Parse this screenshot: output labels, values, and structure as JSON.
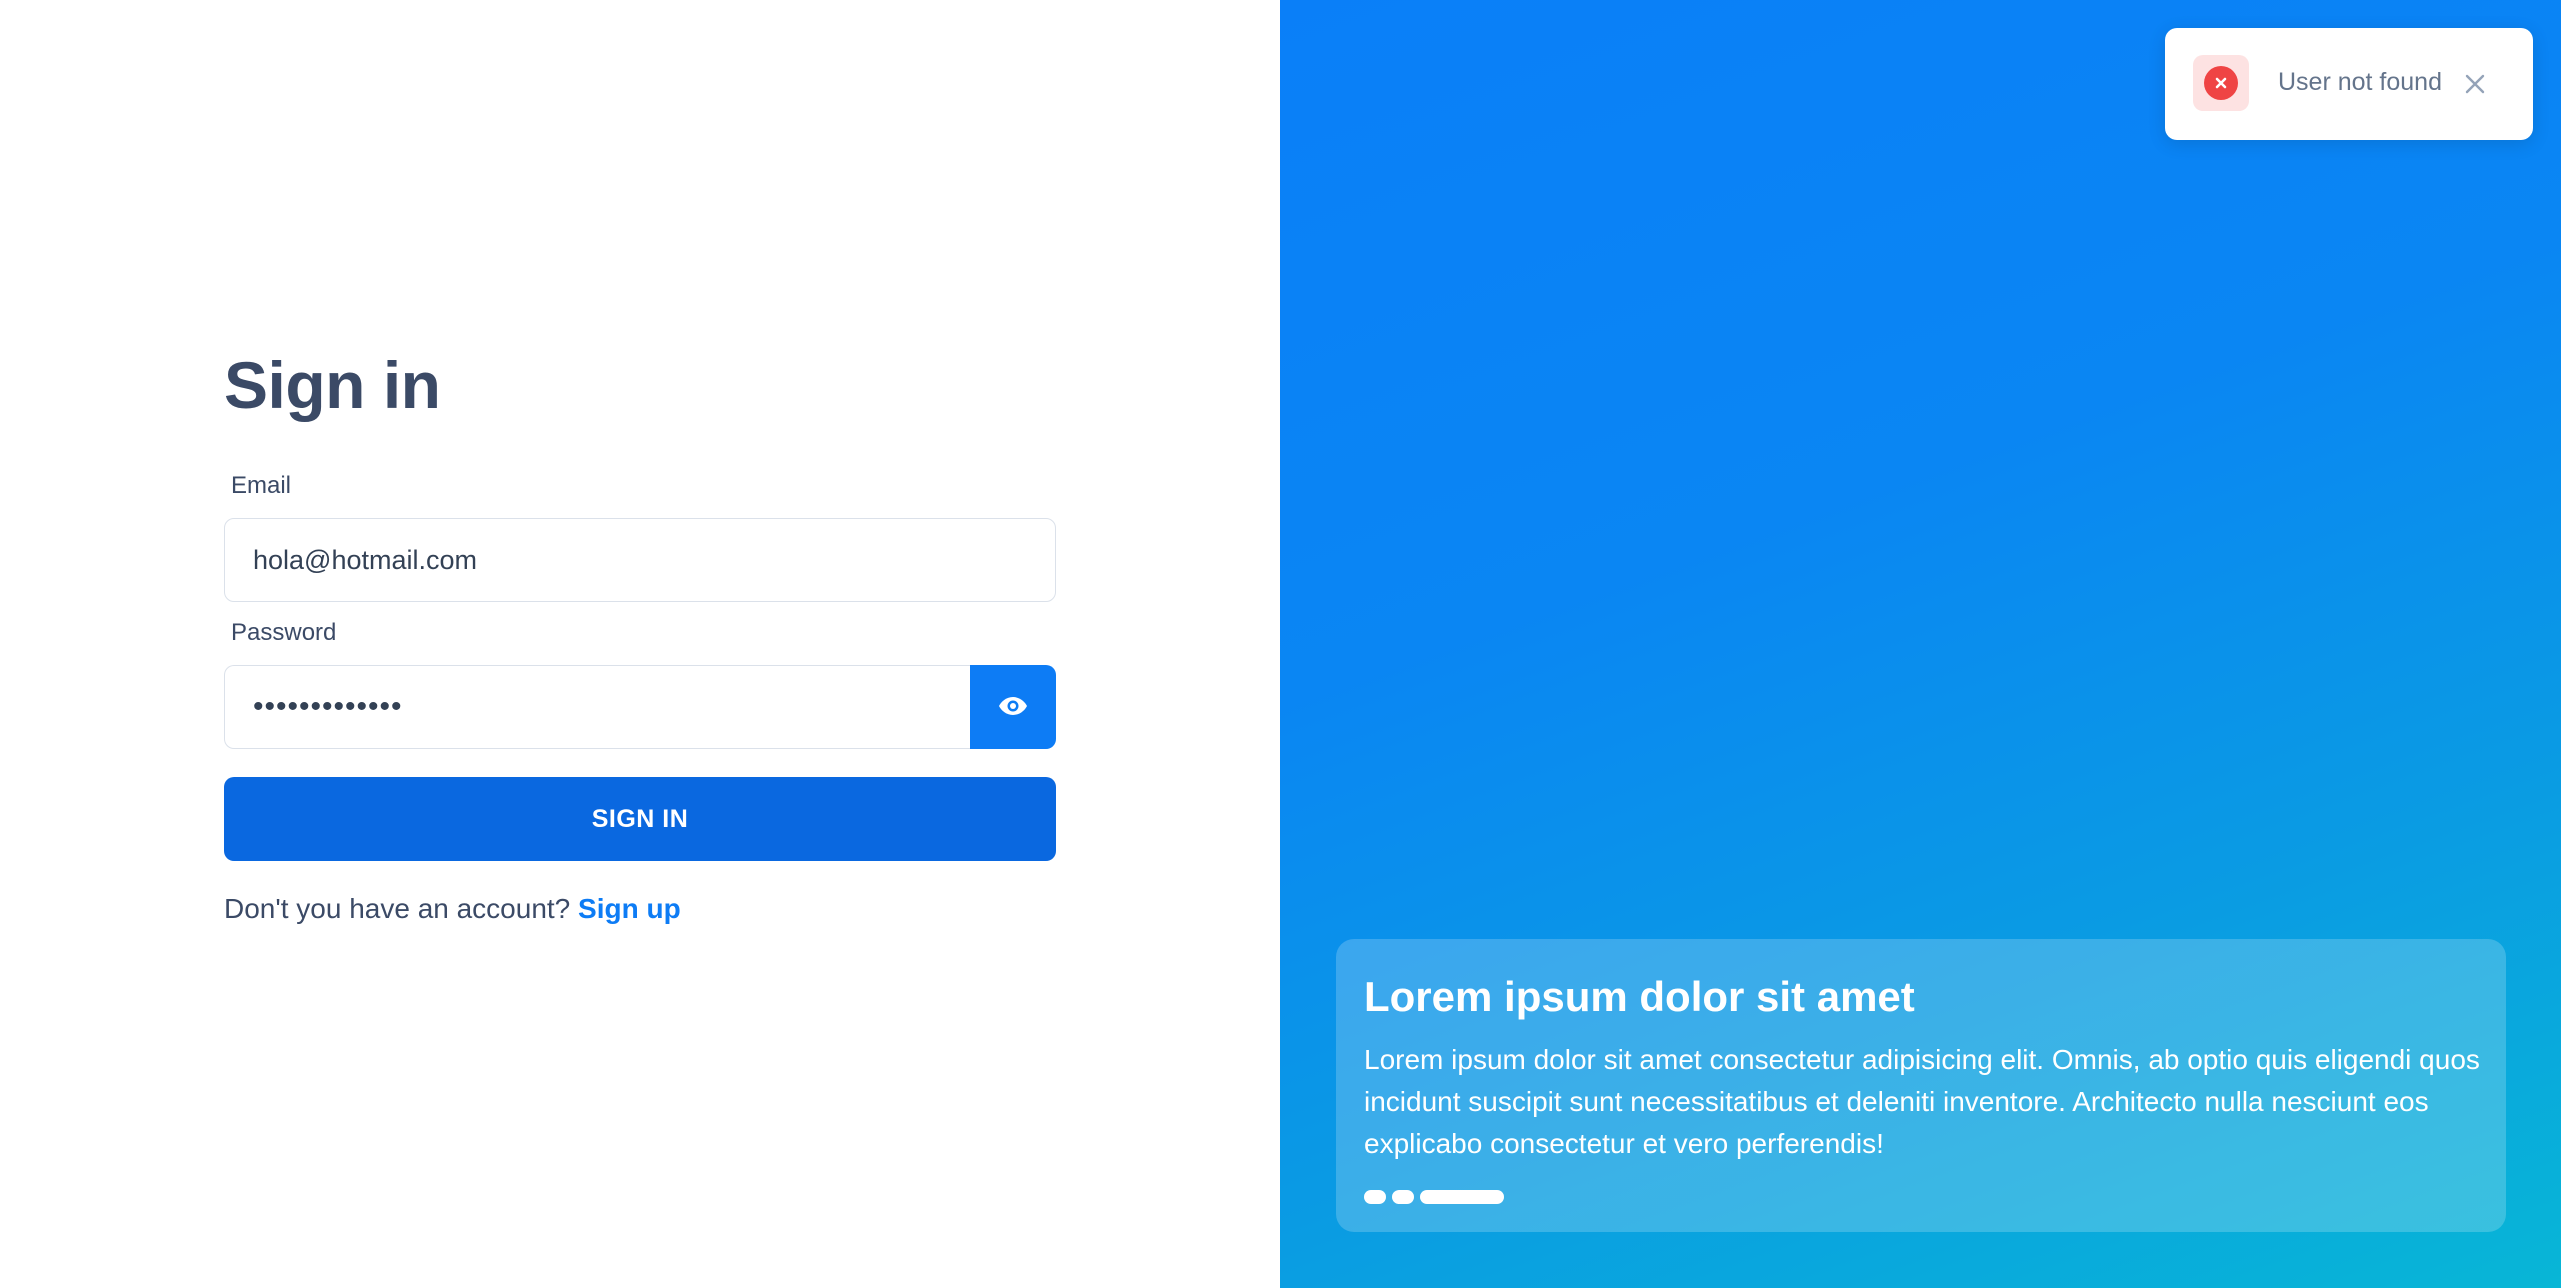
{
  "signin": {
    "title": "Sign in",
    "email_label": "Email",
    "email_value": "hola@hotmail.com",
    "password_label": "Password",
    "password_value": "•••••••••••••",
    "submit_label": "SIGN IN",
    "signup_prompt": "Don't you have an account?",
    "signup_link": "Sign up"
  },
  "toast": {
    "icon": "error-x-icon",
    "message": "User not found",
    "close_icon": "close-icon"
  },
  "card": {
    "title": "Lorem ipsum dolor sit amet",
    "body": "Lorem ipsum dolor sit amet consectetur adipisicing elit. Omnis, ab optio quis eligendi quos incidunt suscipit sunt necessitatibus et deleniti inventore. Architecto nulla nesciunt eos explicabo consectetur et vero perferendis!",
    "carousel_slides": 3,
    "active_slide": 3
  },
  "colors": {
    "primary": "#0d7cf5",
    "button": "#0a68e0",
    "error": "#ef4444",
    "heading": "#3b4a66"
  }
}
